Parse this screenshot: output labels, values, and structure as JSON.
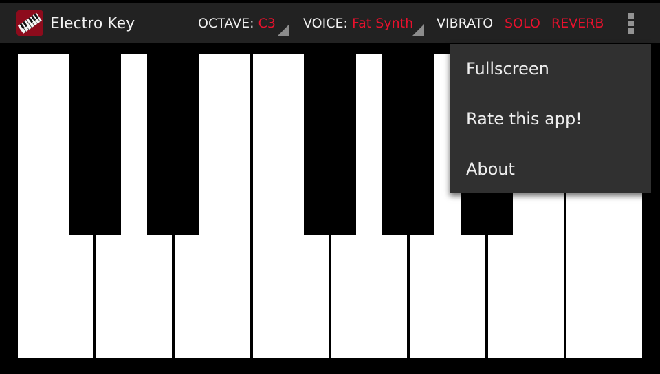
{
  "app": {
    "title": "Electro Key",
    "icon": "piano-keyboard-icon"
  },
  "actionbar": {
    "octave": {
      "label": "OCTAVE:",
      "value": "C3"
    },
    "voice": {
      "label": "VOICE:",
      "value": "Fat Synth"
    },
    "vibrato": {
      "label": "VIBRATO",
      "active": false
    },
    "solo": {
      "label": "SOLO",
      "active": true
    },
    "reverb": {
      "label": "REVERB",
      "active": true
    },
    "overflow_icon": "more-vert-icon"
  },
  "colors": {
    "accent": "#e8112d",
    "actionbar_bg": "#222222",
    "menu_bg": "#303030",
    "text": "#f2f2f2"
  },
  "overflow_menu": {
    "items": [
      {
        "label": "Fullscreen"
      },
      {
        "label": "Rate this app!"
      },
      {
        "label": "About"
      }
    ]
  },
  "keyboard": {
    "white_keys": 8,
    "black_keys": 5
  }
}
